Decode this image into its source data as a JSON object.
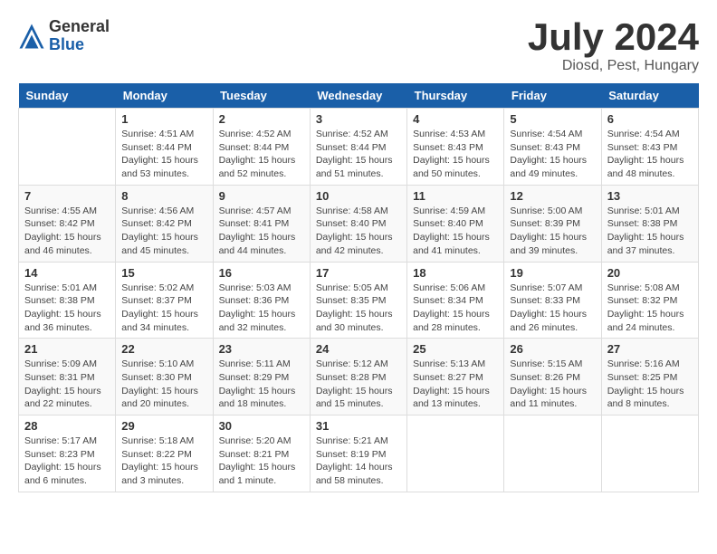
{
  "header": {
    "logo_general": "General",
    "logo_blue": "Blue",
    "title": "July 2024",
    "location": "Diosd, Pest, Hungary"
  },
  "days_of_week": [
    "Sunday",
    "Monday",
    "Tuesday",
    "Wednesday",
    "Thursday",
    "Friday",
    "Saturday"
  ],
  "weeks": [
    [
      {
        "day": "",
        "info": ""
      },
      {
        "day": "1",
        "info": "Sunrise: 4:51 AM\nSunset: 8:44 PM\nDaylight: 15 hours\nand 53 minutes."
      },
      {
        "day": "2",
        "info": "Sunrise: 4:52 AM\nSunset: 8:44 PM\nDaylight: 15 hours\nand 52 minutes."
      },
      {
        "day": "3",
        "info": "Sunrise: 4:52 AM\nSunset: 8:44 PM\nDaylight: 15 hours\nand 51 minutes."
      },
      {
        "day": "4",
        "info": "Sunrise: 4:53 AM\nSunset: 8:43 PM\nDaylight: 15 hours\nand 50 minutes."
      },
      {
        "day": "5",
        "info": "Sunrise: 4:54 AM\nSunset: 8:43 PM\nDaylight: 15 hours\nand 49 minutes."
      },
      {
        "day": "6",
        "info": "Sunrise: 4:54 AM\nSunset: 8:43 PM\nDaylight: 15 hours\nand 48 minutes."
      }
    ],
    [
      {
        "day": "7",
        "info": "Sunrise: 4:55 AM\nSunset: 8:42 PM\nDaylight: 15 hours\nand 46 minutes."
      },
      {
        "day": "8",
        "info": "Sunrise: 4:56 AM\nSunset: 8:42 PM\nDaylight: 15 hours\nand 45 minutes."
      },
      {
        "day": "9",
        "info": "Sunrise: 4:57 AM\nSunset: 8:41 PM\nDaylight: 15 hours\nand 44 minutes."
      },
      {
        "day": "10",
        "info": "Sunrise: 4:58 AM\nSunset: 8:40 PM\nDaylight: 15 hours\nand 42 minutes."
      },
      {
        "day": "11",
        "info": "Sunrise: 4:59 AM\nSunset: 8:40 PM\nDaylight: 15 hours\nand 41 minutes."
      },
      {
        "day": "12",
        "info": "Sunrise: 5:00 AM\nSunset: 8:39 PM\nDaylight: 15 hours\nand 39 minutes."
      },
      {
        "day": "13",
        "info": "Sunrise: 5:01 AM\nSunset: 8:38 PM\nDaylight: 15 hours\nand 37 minutes."
      }
    ],
    [
      {
        "day": "14",
        "info": "Sunrise: 5:01 AM\nSunset: 8:38 PM\nDaylight: 15 hours\nand 36 minutes."
      },
      {
        "day": "15",
        "info": "Sunrise: 5:02 AM\nSunset: 8:37 PM\nDaylight: 15 hours\nand 34 minutes."
      },
      {
        "day": "16",
        "info": "Sunrise: 5:03 AM\nSunset: 8:36 PM\nDaylight: 15 hours\nand 32 minutes."
      },
      {
        "day": "17",
        "info": "Sunrise: 5:05 AM\nSunset: 8:35 PM\nDaylight: 15 hours\nand 30 minutes."
      },
      {
        "day": "18",
        "info": "Sunrise: 5:06 AM\nSunset: 8:34 PM\nDaylight: 15 hours\nand 28 minutes."
      },
      {
        "day": "19",
        "info": "Sunrise: 5:07 AM\nSunset: 8:33 PM\nDaylight: 15 hours\nand 26 minutes."
      },
      {
        "day": "20",
        "info": "Sunrise: 5:08 AM\nSunset: 8:32 PM\nDaylight: 15 hours\nand 24 minutes."
      }
    ],
    [
      {
        "day": "21",
        "info": "Sunrise: 5:09 AM\nSunset: 8:31 PM\nDaylight: 15 hours\nand 22 minutes."
      },
      {
        "day": "22",
        "info": "Sunrise: 5:10 AM\nSunset: 8:30 PM\nDaylight: 15 hours\nand 20 minutes."
      },
      {
        "day": "23",
        "info": "Sunrise: 5:11 AM\nSunset: 8:29 PM\nDaylight: 15 hours\nand 18 minutes."
      },
      {
        "day": "24",
        "info": "Sunrise: 5:12 AM\nSunset: 8:28 PM\nDaylight: 15 hours\nand 15 minutes."
      },
      {
        "day": "25",
        "info": "Sunrise: 5:13 AM\nSunset: 8:27 PM\nDaylight: 15 hours\nand 13 minutes."
      },
      {
        "day": "26",
        "info": "Sunrise: 5:15 AM\nSunset: 8:26 PM\nDaylight: 15 hours\nand 11 minutes."
      },
      {
        "day": "27",
        "info": "Sunrise: 5:16 AM\nSunset: 8:25 PM\nDaylight: 15 hours\nand 8 minutes."
      }
    ],
    [
      {
        "day": "28",
        "info": "Sunrise: 5:17 AM\nSunset: 8:23 PM\nDaylight: 15 hours\nand 6 minutes."
      },
      {
        "day": "29",
        "info": "Sunrise: 5:18 AM\nSunset: 8:22 PM\nDaylight: 15 hours\nand 3 minutes."
      },
      {
        "day": "30",
        "info": "Sunrise: 5:20 AM\nSunset: 8:21 PM\nDaylight: 15 hours\nand 1 minute."
      },
      {
        "day": "31",
        "info": "Sunrise: 5:21 AM\nSunset: 8:19 PM\nDaylight: 14 hours\nand 58 minutes."
      },
      {
        "day": "",
        "info": ""
      },
      {
        "day": "",
        "info": ""
      },
      {
        "day": "",
        "info": ""
      }
    ]
  ]
}
